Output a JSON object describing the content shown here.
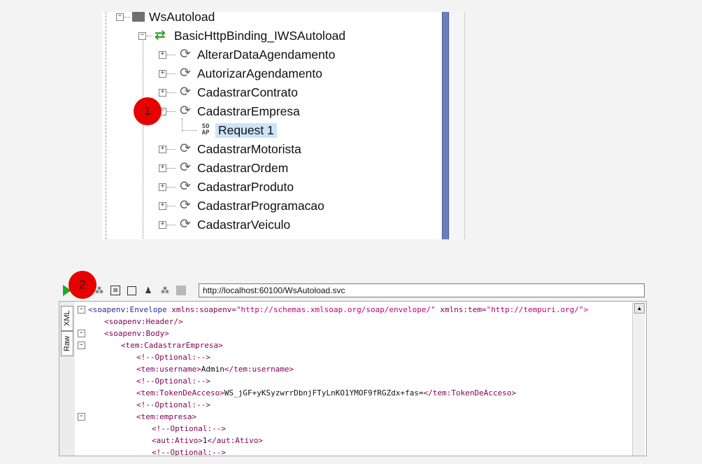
{
  "tree": {
    "service": "WsAutoload",
    "binding": "BasicHttpBinding_IWSAutoload",
    "operations": [
      "AlterarDataAgendamento",
      "AutorizarAgendamento",
      "CadastrarContrato",
      "CadastrarEmpresa",
      "CadastrarMotorista",
      "CadastrarOrdem",
      "CadastrarProduto",
      "CadastrarProgramacao",
      "CadastrarVeiculo"
    ],
    "request": "Request 1",
    "soap_icon_top": "SO",
    "soap_icon_bottom": "AP"
  },
  "markers": {
    "m1": "1",
    "m2": "2"
  },
  "toolbar": {
    "url": "http://localhost:60100/WsAutoload.svc"
  },
  "tabs": {
    "xml": "XML",
    "raw": "Raw"
  },
  "xml": {
    "l1_open": "<soapenv:Envelope",
    "l1_a1": " xmlns:soapenv=",
    "l1_v1": "\"http://schemas.xmlsoap.org/soap/envelope/\"",
    "l1_a2": " xmlns:tem=",
    "l1_v2": "\"http://tempuri.org/\">",
    "l2": "<soapenv:Header/>",
    "l3": "<soapenv:Body>",
    "l4": "<tem:CadastrarEmpresa>",
    "c1": "<!--Optional:-->",
    "l6_open": "<tem:username>",
    "l6_text": "Admin",
    "l6_close": "</tem:username>",
    "c2": "<!--Optional:-->",
    "l8_open": "<tem:TokenDeAcceso>",
    "l8_text": "WS_jGF+yKSyzwrrDbnjFTyLnKO1YMOF9fRGZdx+fas=",
    "l8_close": "</tem:TokenDeAcceso>",
    "c3": "<!--Optional:-->",
    "l10": "<tem:empresa>",
    "c4": "<!--Optional:-->",
    "l12_open": "<aut:Ativo>",
    "l12_text": "1",
    "l12_close": "</aut:Ativo>",
    "c5": "<!--Optional:-->"
  }
}
